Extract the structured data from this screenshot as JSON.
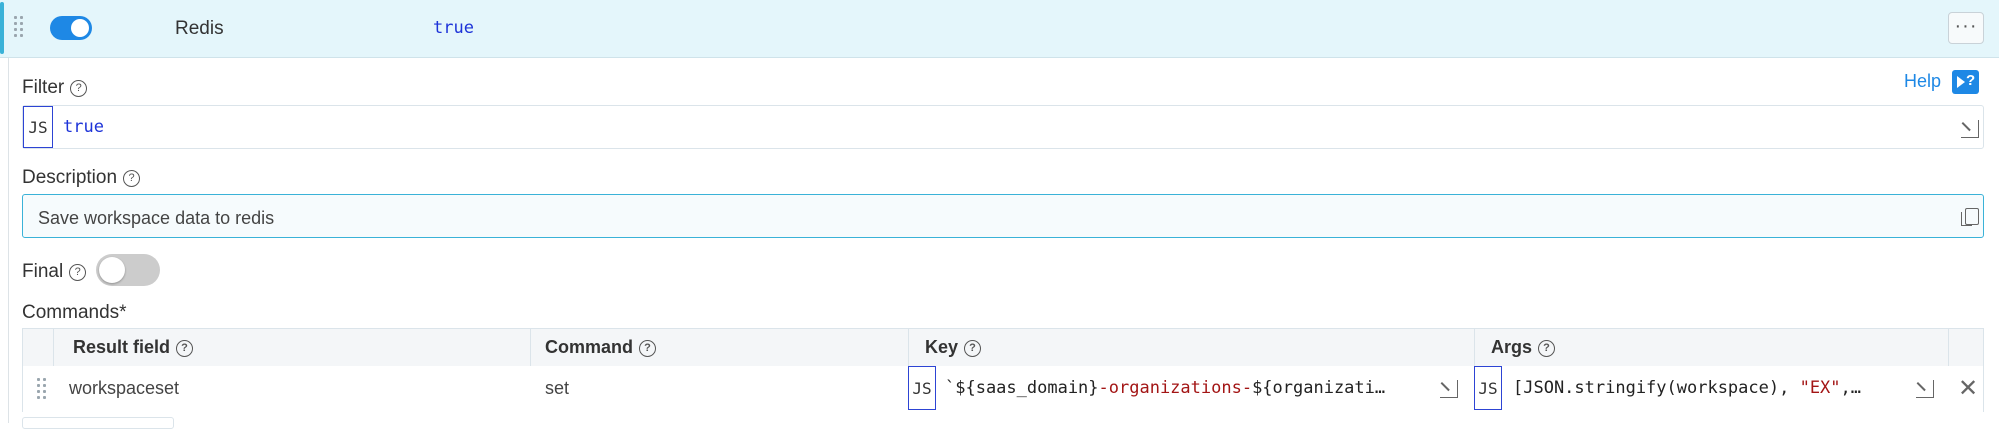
{
  "header": {
    "rule_name": "Redis",
    "rule_filter": "true",
    "more_label": "···"
  },
  "help": {
    "label": "Help"
  },
  "filter": {
    "label": "Filter",
    "js_badge": "JS",
    "value": "true"
  },
  "description": {
    "label": "Description",
    "value": "Save workspace data to redis"
  },
  "final": {
    "label": "Final",
    "enabled": false
  },
  "commands": {
    "label": "Commands*",
    "columns": [
      "Result field",
      "Command",
      "Key",
      "Args"
    ],
    "rows": [
      {
        "result_field": "workspaceset",
        "command": "set",
        "key_badge": "JS",
        "key_parts": [
          "`${saas_domain}",
          "-organizations-",
          "${organizati…"
        ],
        "args_badge": "JS",
        "args_parts": [
          "[JSON.stringify(workspace), ",
          "\"EX\"",
          ",…"
        ]
      }
    ],
    "remove_label": "✕"
  },
  "icons": {
    "help": "question-circle-icon",
    "expand": "expand-editor-icon",
    "copy": "copy-icon",
    "drag": "drag-handle-icon",
    "close": "close-icon"
  },
  "colors": {
    "header_bg": "#e4f6fb",
    "accent": "#3ab2d8",
    "toggle_on": "#1e88e5",
    "toggle_off": "#cccccc",
    "code_keyword": "#1d33d8",
    "code_string": "#a31515"
  }
}
